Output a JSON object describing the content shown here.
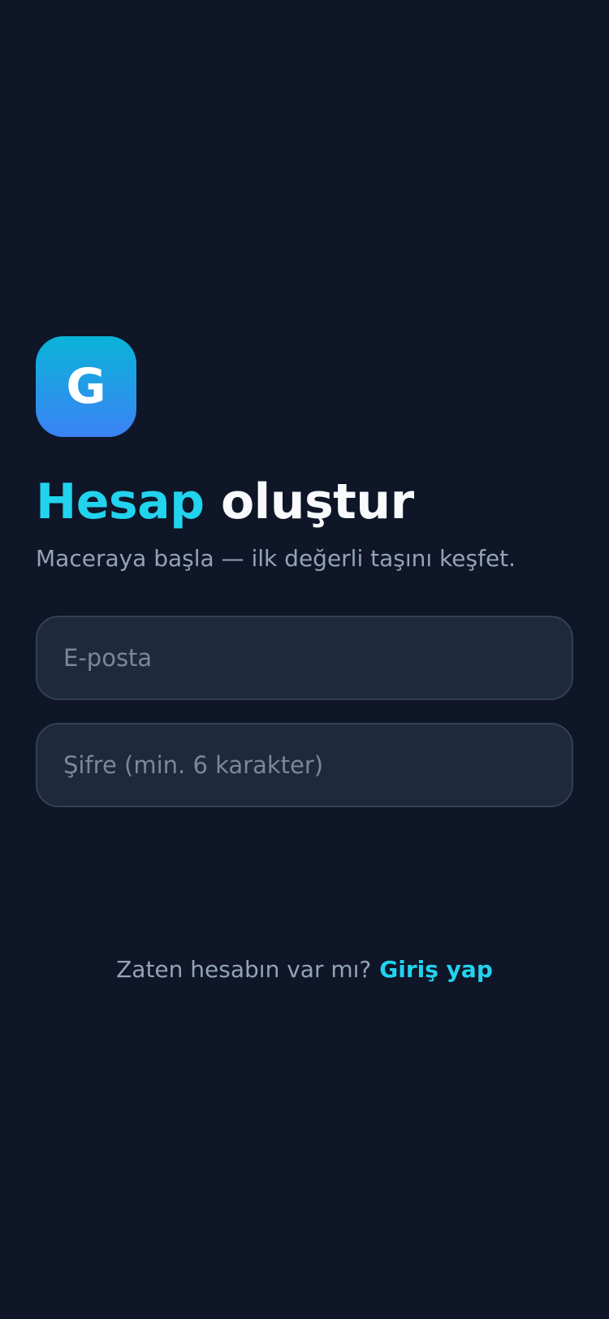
{
  "logo": {
    "letter": "G",
    "gradient_start": "#0ab4d8",
    "gradient_end": "#3b82f6"
  },
  "header": {
    "title_accent": "Hesap",
    "title_rest": "oluştur",
    "subtitle": "Maceraya başla — ilk değerli taşını keşfet."
  },
  "form": {
    "email": {
      "value": "",
      "placeholder": "E-posta"
    },
    "password": {
      "value": "",
      "placeholder": "Şifre (min. 6 karakter)"
    }
  },
  "footer": {
    "question": "Zaten hesabın var mı?",
    "login_link": "Giriş yap"
  },
  "colors": {
    "background": "#0e1628",
    "accent": "#22d3ee",
    "field_background": "#1e293b",
    "field_border": "#334155",
    "muted_text": "#94a3b8"
  }
}
